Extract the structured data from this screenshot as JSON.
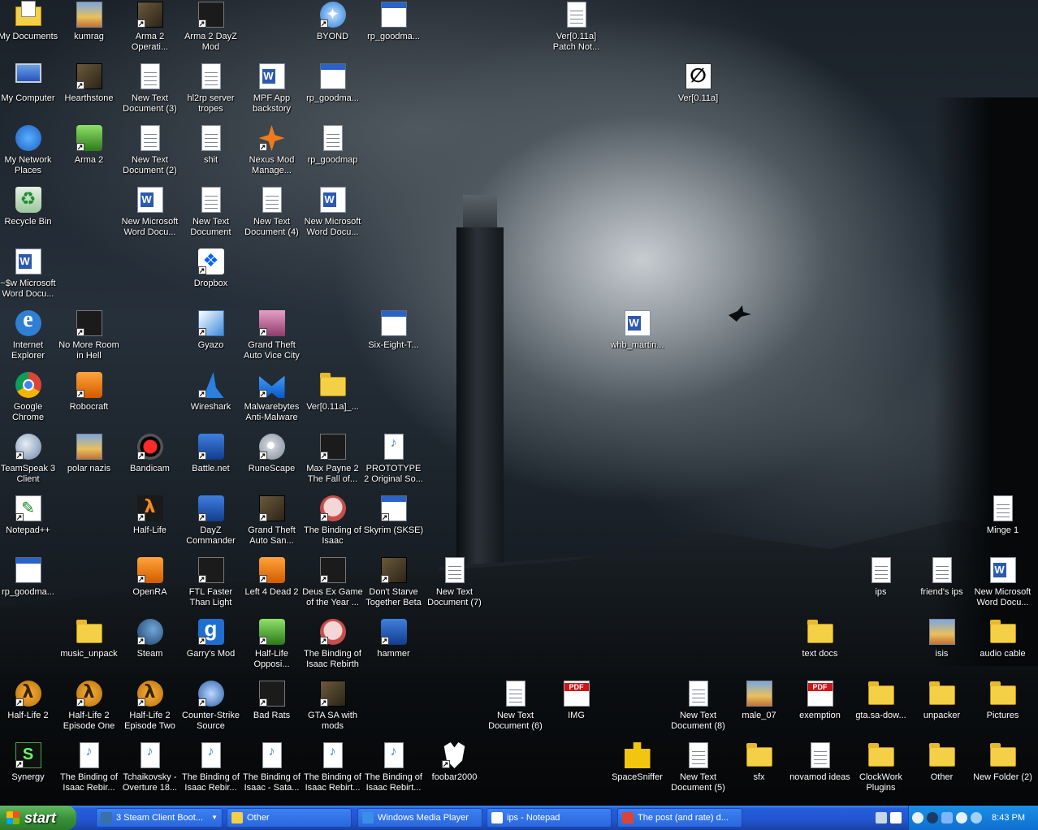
{
  "desktop": {
    "icons": [
      {
        "label": "My Documents",
        "glyph": "mydocs",
        "shortcut": false
      },
      {
        "label": "kumrag",
        "glyph": "image",
        "shortcut": false
      },
      {
        "label": "Arma 2 Operati...",
        "glyph": "game",
        "shortcut": true
      },
      {
        "label": "Arma 2 DayZ Mod",
        "glyph": "dark",
        "shortcut": true
      },
      {
        "label": "BYOND",
        "glyph": "byond",
        "shortcut": true
      },
      {
        "label": "rp_goodma...",
        "glyph": "exe",
        "shortcut": false
      },
      {
        "label": "Ver[0.11a] Patch Not...",
        "glyph": "doc",
        "shortcut": false
      },
      {
        "label": "My Computer",
        "glyph": "pc",
        "shortcut": false
      },
      {
        "label": "Hearthstone",
        "glyph": "game",
        "shortcut": true
      },
      {
        "label": "New Text Document (3)",
        "glyph": "doc",
        "shortcut": false
      },
      {
        "label": "hl2rp server tropes",
        "glyph": "doc",
        "shortcut": false
      },
      {
        "label": "MPF App backstory",
        "glyph": "word",
        "shortcut": false
      },
      {
        "label": "rp_goodma...",
        "glyph": "exe",
        "shortcut": false
      },
      {
        "label": "Ver[0.11a]",
        "glyph": "sixeight",
        "shortcut": false
      },
      {
        "label": "My Network Places",
        "glyph": "net",
        "shortcut": false
      },
      {
        "label": "Arma 2",
        "glyph": "green",
        "shortcut": true
      },
      {
        "label": "New Text Document (2)",
        "glyph": "doc",
        "shortcut": false
      },
      {
        "label": "shit",
        "glyph": "doc",
        "shortcut": false
      },
      {
        "label": "Nexus Mod Manage...",
        "glyph": "nexus",
        "shortcut": true
      },
      {
        "label": "rp_goodmap",
        "glyph": "doc",
        "shortcut": false
      },
      {
        "label": "Recycle Bin",
        "glyph": "recycle",
        "shortcut": false
      },
      {
        "label": "New Microsoft Word Docu...",
        "glyph": "word",
        "shortcut": false
      },
      {
        "label": "New Text Document",
        "glyph": "doc",
        "shortcut": false
      },
      {
        "label": "New Text Document (4)",
        "glyph": "doc",
        "shortcut": false
      },
      {
        "label": "New Microsoft Word Docu...",
        "glyph": "word",
        "shortcut": false
      },
      {
        "label": "~$w Microsoft Word Docu...",
        "glyph": "word",
        "shortcut": false
      },
      {
        "label": "Dropbox",
        "glyph": "dropbox",
        "shortcut": true
      },
      {
        "label": "Internet Explorer",
        "glyph": "ie",
        "shortcut": false
      },
      {
        "label": "No More Room in Hell",
        "glyph": "dark",
        "shortcut": true
      },
      {
        "label": "Gyazo",
        "glyph": "gyazo",
        "shortcut": true
      },
      {
        "label": "Grand Theft Auto Vice City",
        "glyph": "pink",
        "shortcut": true
      },
      {
        "label": "Six-Eight-T...",
        "glyph": "exe",
        "shortcut": false
      },
      {
        "label": "whb_martin...",
        "glyph": "word",
        "shortcut": false
      },
      {
        "label": "Google Chrome",
        "glyph": "chrome",
        "shortcut": false
      },
      {
        "label": "Robocraft",
        "glyph": "orange",
        "shortcut": true
      },
      {
        "label": "Wireshark",
        "glyph": "shark",
        "shortcut": true
      },
      {
        "label": "Malwarebytes Anti-Malware",
        "glyph": "mal",
        "shortcut": true
      },
      {
        "label": "Ver[0.11a]_...",
        "glyph": "folder",
        "shortcut": false
      },
      {
        "label": "TeamSpeak 3 Client",
        "glyph": "ts",
        "shortcut": true
      },
      {
        "label": "polar nazis",
        "glyph": "image",
        "shortcut": false
      },
      {
        "label": "Bandicam",
        "glyph": "red",
        "shortcut": true
      },
      {
        "label": "Battle.net",
        "glyph": "blue",
        "shortcut": true
      },
      {
        "label": "RuneScape",
        "glyph": "disc",
        "shortcut": true
      },
      {
        "label": "Max Payne 2 The Fall of...",
        "glyph": "dark",
        "shortcut": true
      },
      {
        "label": "PROTOTYPE 2 Original So...",
        "glyph": "mp3",
        "shortcut": false
      },
      {
        "label": "Notepad++",
        "glyph": "np",
        "shortcut": true
      },
      {
        "label": "Half-Life",
        "glyph": "hl",
        "shortcut": true
      },
      {
        "label": "DayZ Commander",
        "glyph": "blue",
        "shortcut": true
      },
      {
        "label": "Grand Theft Auto San...",
        "glyph": "game",
        "shortcut": true
      },
      {
        "label": "The Binding of Isaac",
        "glyph": "isaac",
        "shortcut": true
      },
      {
        "label": "Skyrim (SKSE)",
        "glyph": "exe",
        "shortcut": true
      },
      {
        "label": "Minge 1",
        "glyph": "doc",
        "shortcut": false
      },
      {
        "label": "rp_goodma...",
        "glyph": "exe",
        "shortcut": false
      },
      {
        "label": "OpenRA",
        "glyph": "orange",
        "shortcut": true
      },
      {
        "label": "FTL Faster Than Light",
        "glyph": "dark",
        "shortcut": true
      },
      {
        "label": "Left 4 Dead 2",
        "glyph": "orange",
        "shortcut": true
      },
      {
        "label": "Deus Ex Game of the Year ...",
        "glyph": "dark",
        "shortcut": true
      },
      {
        "label": "Don't Starve Together Beta",
        "glyph": "game",
        "shortcut": true
      },
      {
        "label": "New Text Document (7)",
        "glyph": "doc",
        "shortcut": false
      },
      {
        "label": "ips",
        "glyph": "doc",
        "shortcut": false
      },
      {
        "label": "friend's ips",
        "glyph": "doc",
        "shortcut": false
      },
      {
        "label": "New Microsoft Word Docu...",
        "glyph": "word",
        "shortcut": false
      },
      {
        "label": "music_unpack",
        "glyph": "folder",
        "shortcut": false
      },
      {
        "label": "Steam",
        "glyph": "steam",
        "shortcut": true
      },
      {
        "label": "Garry's Mod",
        "glyph": "gmod",
        "shortcut": true
      },
      {
        "label": "Half-Life Opposi...",
        "glyph": "green",
        "shortcut": true
      },
      {
        "label": "The Binding of Isaac Rebirth",
        "glyph": "isaac",
        "shortcut": true
      },
      {
        "label": "hammer",
        "glyph": "blue",
        "shortcut": true
      },
      {
        "label": "text docs",
        "glyph": "folder",
        "shortcut": false
      },
      {
        "label": "isis",
        "glyph": "image",
        "shortcut": false
      },
      {
        "label": "audio cable",
        "glyph": "folder",
        "shortcut": false
      },
      {
        "label": "Half-Life 2",
        "glyph": "hl2",
        "shortcut": true
      },
      {
        "label": "Half-Life 2 Episode One",
        "glyph": "hl2",
        "shortcut": true
      },
      {
        "label": "Half-Life 2 Episode Two",
        "glyph": "hl2",
        "shortcut": true
      },
      {
        "label": "Counter-Strike Source",
        "glyph": "blueface",
        "shortcut": true
      },
      {
        "label": "Bad Rats",
        "glyph": "dark",
        "shortcut": true
      },
      {
        "label": "GTA SA with mods",
        "glyph": "game",
        "shortcut": true
      },
      {
        "label": "New Text Document (6)",
        "glyph": "doc",
        "shortcut": false
      },
      {
        "label": "IMG",
        "glyph": "pdf",
        "shortcut": false
      },
      {
        "label": "New Text Document (8)",
        "glyph": "doc",
        "shortcut": false
      },
      {
        "label": "male_07",
        "glyph": "image",
        "shortcut": false
      },
      {
        "label": "exemption",
        "glyph": "pdf",
        "shortcut": false
      },
      {
        "label": "gta.sa-dow...",
        "glyph": "folder",
        "shortcut": false
      },
      {
        "label": "unpacker",
        "glyph": "folder",
        "shortcut": false
      },
      {
        "label": "Pictures",
        "glyph": "folder",
        "shortcut": false
      },
      {
        "label": "Synergy",
        "glyph": "synergy",
        "shortcut": true
      },
      {
        "label": "The Binding of Isaac Rebir...",
        "glyph": "mp3",
        "shortcut": false
      },
      {
        "label": "Tchaikovsky - Overture 18...",
        "glyph": "mp3",
        "shortcut": false
      },
      {
        "label": "The Binding of Isaac Rebir...",
        "glyph": "mp3",
        "shortcut": false
      },
      {
        "label": "The Binding of Isaac - Sata...",
        "glyph": "mp3",
        "shortcut": false
      },
      {
        "label": "The Binding of Isaac Rebirt...",
        "glyph": "mp3",
        "shortcut": false
      },
      {
        "label": "The Binding of Isaac Rebirt...",
        "glyph": "mp3",
        "shortcut": false
      },
      {
        "label": "foobar2000",
        "glyph": "foobar",
        "shortcut": true
      },
      {
        "label": "SpaceSniffer",
        "glyph": "puzzle",
        "shortcut": false
      },
      {
        "label": "New Text Document (5)",
        "glyph": "doc",
        "shortcut": false
      },
      {
        "label": "sfx",
        "glyph": "folder",
        "shortcut": false
      },
      {
        "label": "novamod ideas",
        "glyph": "doc",
        "shortcut": false
      },
      {
        "label": "ClockWork Plugins",
        "glyph": "folder",
        "shortcut": false
      },
      {
        "label": "Other",
        "glyph": "folder",
        "shortcut": false
      },
      {
        "label": "New Folder (2)",
        "glyph": "folder",
        "shortcut": false
      }
    ]
  },
  "taskbar": {
    "start_label": "start",
    "tasks": [
      {
        "label": "3 Steam Client Boot...",
        "color": "#3b6fa8",
        "has_arrow": true
      },
      {
        "label": "Other",
        "color": "#f4d046",
        "has_arrow": false
      },
      {
        "label": "Windows Media Player",
        "color": "#3a8ee8",
        "has_arrow": false
      },
      {
        "label": "ips - Notepad",
        "color": "#ffffff",
        "has_arrow": false
      },
      {
        "label": "The post (and rate) d...",
        "color": "#db4437",
        "has_arrow": false
      }
    ],
    "clock": "8:43 PM"
  },
  "colors": {
    "taskbar_blue": "#245edb",
    "start_green": "#3a943a",
    "tray_blue": "#0f6fd0"
  }
}
